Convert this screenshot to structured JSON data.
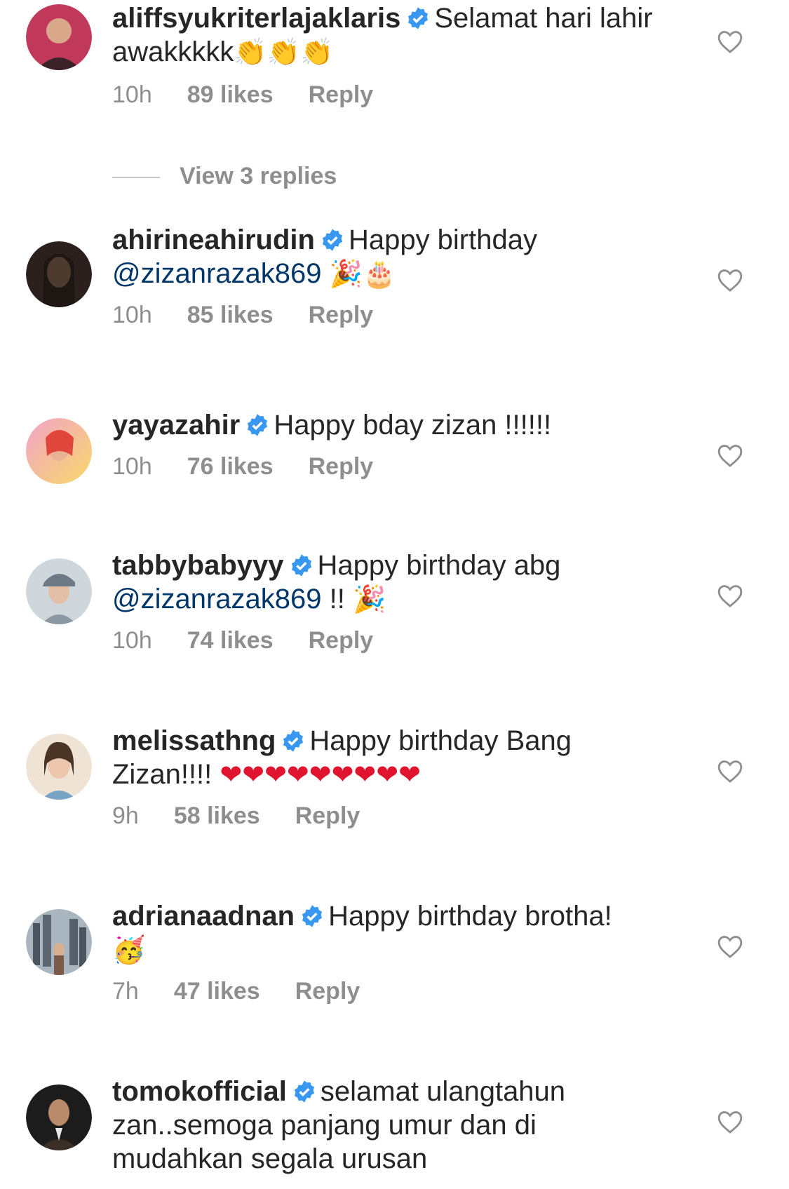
{
  "comments": [
    {
      "username": "aliffsyukriterlajaklaris",
      "text": "Selamat hari lahir awakkkkk",
      "mention": "",
      "emoji": "👏👏👏",
      "emoji_color": "#e7a718",
      "time": "10h",
      "likes": "89 likes",
      "reply": "Reply",
      "avatar_colors": [
        "#c0395a",
        "#8a2a3a"
      ]
    },
    {
      "username": "ahirineahirudin",
      "text": "Happy birthday",
      "mention": "@zizanrazak869",
      "emoji": "🎉🎂",
      "emoji_color": "#e7a718",
      "time": "10h",
      "likes": "85 likes",
      "reply": "Reply",
      "avatar_colors": [
        "#3a2a24",
        "#1b1412"
      ]
    },
    {
      "username": "yayazahir",
      "text": "Happy bday zizan !!!!!!",
      "mention": "",
      "emoji": "",
      "emoji_color": "",
      "time": "10h",
      "likes": "76 likes",
      "reply": "Reply",
      "avatar_colors": [
        "#f2a3c8",
        "#f7d96a"
      ]
    },
    {
      "username": "tabbybabyyy",
      "text": "Happy birthday abg",
      "mention": "@zizanrazak869",
      "suffix": " !! ",
      "emoji": "🎉",
      "emoji_color": "#e7a718",
      "time": "10h",
      "likes": "74 likes",
      "reply": "Reply",
      "avatar_colors": [
        "#cfd6dc",
        "#7c8a96"
      ]
    },
    {
      "username": "melissathng",
      "text": "Happy birthday Bang Zizan!!!! ",
      "mention": "",
      "emoji": "❤❤❤❤❤❤❤❤❤",
      "emoji_color": "#e0142e",
      "time": "9h",
      "likes": "58 likes",
      "reply": "Reply",
      "avatar_colors": [
        "#e8d8c8",
        "#b48a6a"
      ]
    },
    {
      "username": "adrianaadnan",
      "text": "Happy birthday brotha!",
      "mention": "",
      "emoji": "🥳",
      "emoji_color": "#e7a718",
      "time": "7h",
      "likes": "47 likes",
      "reply": "Reply",
      "avatar_colors": [
        "#6b7a86",
        "#3c4650"
      ]
    },
    {
      "username": "tomokofficial",
      "text": "selamat ulangtahun zan..semoga panjang umur dan di mudahkan segala urusan",
      "mention": "",
      "emoji": "",
      "emoji_color": "",
      "time": "",
      "likes": "",
      "reply": "",
      "avatar_colors": [
        "#2a2a2a",
        "#111111"
      ]
    }
  ],
  "view_replies": "View 3 replies",
  "colors": {
    "verified": "#3897f0",
    "meta": "#8e8e8e",
    "mention": "#00376b"
  },
  "icons": {
    "like": "heart-outline-icon",
    "verified": "verified-badge-icon"
  }
}
